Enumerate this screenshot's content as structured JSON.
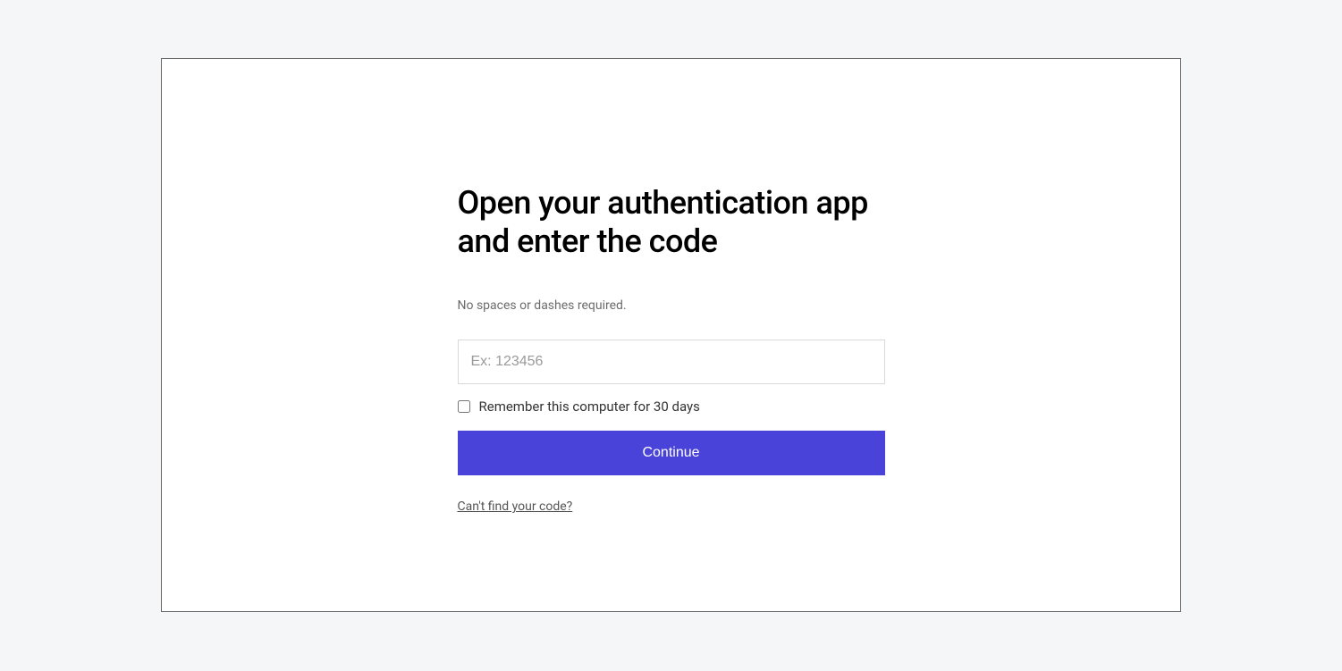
{
  "auth": {
    "heading": "Open your authentication app and enter the code",
    "subtext": "No spaces or dashes required.",
    "input_placeholder": "Ex: 123456",
    "remember_label": "Remember this computer for 30 days",
    "continue_label": "Continue",
    "help_link": "Can't find your code?"
  }
}
